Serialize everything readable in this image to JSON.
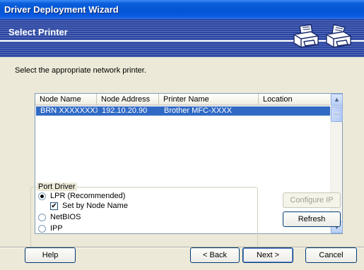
{
  "window": {
    "title": "Driver Deployment Wizard"
  },
  "header": {
    "title": "Select Printer"
  },
  "prompt": "Select the appropriate network printer.",
  "printer_list": {
    "columns": [
      "Node Name",
      "Node Address",
      "Printer Name",
      "Location"
    ],
    "rows": [
      {
        "node_name": "BRN XXXXXXXXX",
        "node_address": "192.10.20.90",
        "printer_name": "Brother   MFC-XXXX",
        "location": "",
        "selected": true
      }
    ]
  },
  "port_driver": {
    "label": "Port Driver",
    "options": [
      {
        "label": "LPR (Recommended)",
        "selected": true
      },
      {
        "label": "NetBIOS",
        "selected": false
      },
      {
        "label": "IPP",
        "selected": false
      }
    ],
    "set_by_node_name": {
      "label": "Set by Node Name",
      "checked": true
    }
  },
  "buttons": {
    "configure_ip": "Configure IP",
    "refresh": "Refresh",
    "help": "Help",
    "back": "< Back",
    "next": "Next >",
    "cancel": "Cancel"
  },
  "colors": {
    "titlebar": "#0454d4",
    "header": "#2b46a3",
    "selection": "#316ac5",
    "dialog": "#ece9d8"
  }
}
